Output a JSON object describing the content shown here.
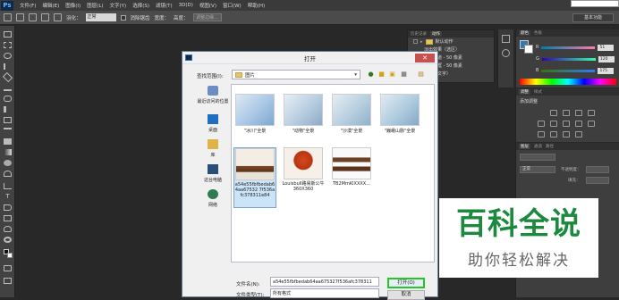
{
  "app": {
    "logo": "Ps",
    "menu": [
      "文件(F)",
      "编辑(E)",
      "图像(I)",
      "图层(L)",
      "文字(Y)",
      "选择(S)",
      "滤镜(T)",
      "3D(D)",
      "视图(V)",
      "窗口(W)",
      "帮助(H)"
    ]
  },
  "options": {
    "feather_label": "羽化：",
    "style_value": "正常",
    "anti_alias": "消除锯齿",
    "width_label": "宽度：",
    "height_label": "高度：",
    "refine_edge": "调整边缘...",
    "workspace": "基本功能"
  },
  "actions_panel": {
    "tabs": [
      "历史记录",
      "动作"
    ],
    "items": [
      "默认动作",
      "淡出效果（选区）",
      "画框通道 - 50 像素",
      "木质画框 - 50 像素",
      "投影（文字）"
    ]
  },
  "color_panel": {
    "tabs": [
      "颜色",
      "色板"
    ],
    "r": "51",
    "g": "120",
    "b": "175",
    "r_label": "R",
    "g_label": "G",
    "b_label": "B",
    "accent": "#3378af"
  },
  "adjust_panel": {
    "tabs": [
      "调整",
      "样式"
    ],
    "title": "添加调整"
  },
  "layers_panel": {
    "tabs": [
      "图层",
      "通道",
      "路径"
    ],
    "blend": "正常",
    "opacity_label": "不透明度：",
    "fill_label": "填充："
  },
  "dialog": {
    "title": "打开",
    "lookin_label": "查找范围(I):",
    "lookin_value": "图片",
    "places": [
      "最近访问的位置",
      "桌面",
      "库",
      "这台电脑",
      "网络"
    ],
    "files": [
      {
        "name": "\"冰川\"全景"
      },
      {
        "name": "\"动物\"全景"
      },
      {
        "name": "\"沙漠\"全景"
      },
      {
        "name": "\"巍峨山脉\"全景"
      },
      {
        "name": "a54e55fbfbedab64aa67532 7f536afc378311e84"
      },
      {
        "name": "Louisbull路易斯公牛360X360"
      },
      {
        "name": "TB2MmKlXXXX..."
      }
    ],
    "filename_label": "文件名(N):",
    "filename_value": "a54e55fbfbedab64aa675327f536afc378311",
    "filetype_label": "文件类型(T):",
    "filetype_value": "所有格式",
    "open_button": "打开(O)",
    "cancel_button": "取消"
  },
  "watermark": {
    "main": "百科全说",
    "sub": "助你轻松解决"
  }
}
